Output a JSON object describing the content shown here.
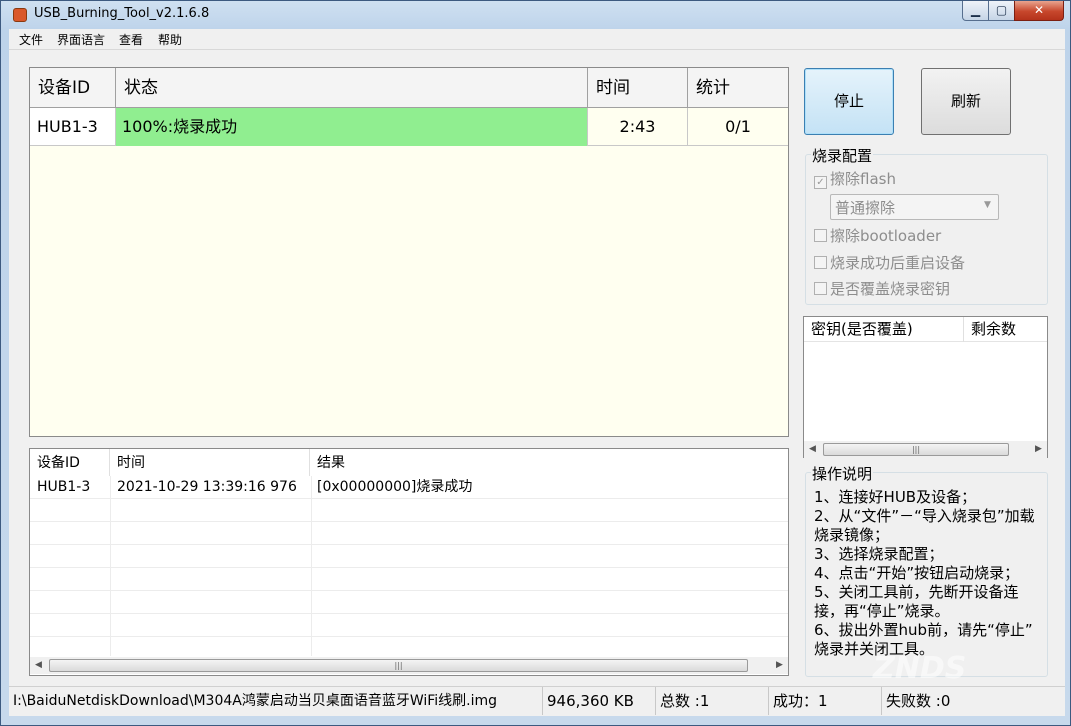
{
  "window": {
    "title": "USB_Burning_Tool_v2.1.6.8"
  },
  "menu": {
    "items": [
      "文件",
      "界面语言",
      "查看",
      "帮助"
    ]
  },
  "device_grid": {
    "columns": [
      "设备ID",
      "状态",
      "时间",
      "统计"
    ],
    "rows": [
      {
        "device_id": "HUB1-3",
        "status": "100%:烧录成功",
        "time": "2:43",
        "stats": "0/1",
        "progress_percent": 100
      }
    ],
    "colors": {
      "progress": "#90ee90",
      "background": "#fffff0"
    }
  },
  "log": {
    "columns": [
      "设备ID",
      "时间",
      "结果"
    ],
    "rows": [
      {
        "device_id": "HUB1-3",
        "time": "2021-10-29 13:39:16 976",
        "result": "[0x00000000]烧录成功"
      }
    ]
  },
  "buttons": {
    "stop": "停止",
    "refresh": "刷新"
  },
  "burn_config": {
    "title": "烧录配置",
    "erase_flash": {
      "label": "擦除flash",
      "checked": true,
      "enabled": false
    },
    "erase_mode": {
      "value": "普通擦除"
    },
    "erase_bootloader": {
      "label": "擦除bootloader",
      "checked": false
    },
    "reboot_after": {
      "label": "烧录成功后重启设备",
      "checked": false
    },
    "overwrite_key": {
      "label": "是否覆盖烧录密钥",
      "checked": false
    }
  },
  "key_list": {
    "columns": [
      "密钥(是否覆盖)",
      "剩余数"
    ]
  },
  "instructions": {
    "title": "操作说明",
    "lines": [
      "1、连接好HUB及设备；",
      "2、从“文件”－“导入烧录包”加载",
      "烧录镜像；",
      "3、选择烧录配置；",
      "4、点击“开始”按钮启动烧录；",
      "5、关闭工具前，先断开设备连",
      "接，再“停止”烧录。",
      "6、拔出外置hub前，请先“停止”",
      "烧录并关闭工具。"
    ]
  },
  "status_bar": {
    "path": "I:\\BaiduNetdiskDownload\\M304A鸿蒙启动当贝桌面语音蓝牙WiFi线刷.img",
    "size": "946,360 KB",
    "total": "总数 :1",
    "success": "成功：1",
    "failed": "失败数 :0"
  },
  "watermark": "ZNDS"
}
